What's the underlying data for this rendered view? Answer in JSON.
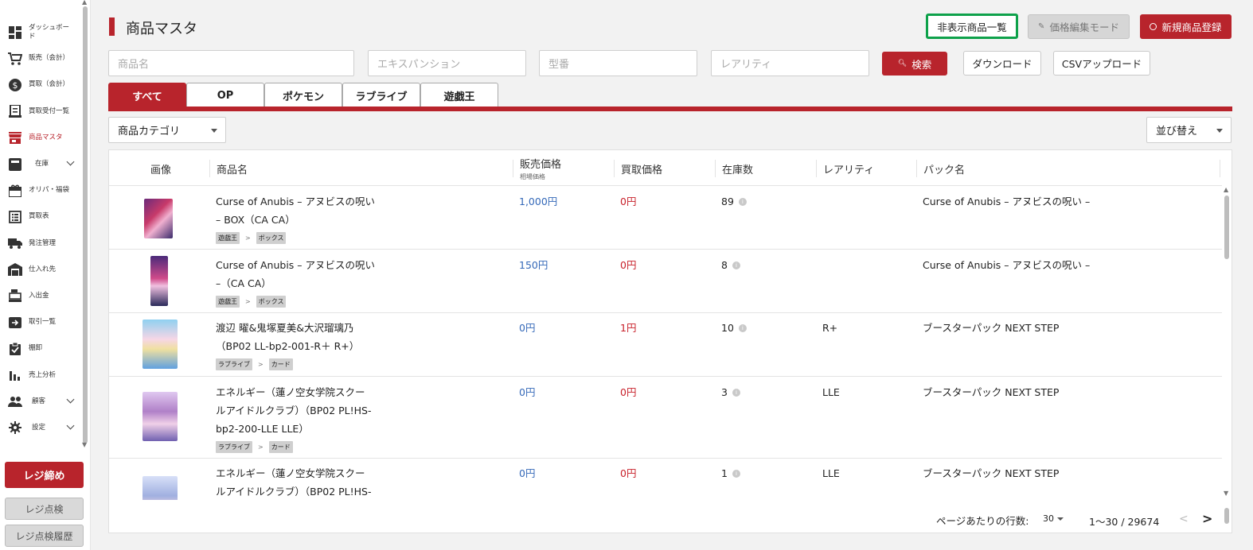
{
  "sidebar": {
    "items": [
      {
        "label": "ダッシュボード",
        "icon": "dashboard-icon"
      },
      {
        "label": "販売（会計）",
        "icon": "cart-icon"
      },
      {
        "label": "買取（会計）",
        "icon": "dollar-icon"
      },
      {
        "label": "買取受付一覧",
        "icon": "receipt-icon"
      },
      {
        "label": "商品マスタ",
        "icon": "store-icon",
        "active": true
      },
      {
        "label": "在庫",
        "icon": "inbox-icon",
        "expandable": true
      },
      {
        "label": "オリパ・福袋",
        "icon": "gift-icon"
      },
      {
        "label": "買取表",
        "icon": "list-icon"
      },
      {
        "label": "発注管理",
        "icon": "truck-icon"
      },
      {
        "label": "仕入れ先",
        "icon": "warehouse-icon"
      },
      {
        "label": "入出金",
        "icon": "register-icon"
      },
      {
        "label": "取引一覧",
        "icon": "transaction-icon"
      },
      {
        "label": "棚卸",
        "icon": "checklist-icon"
      },
      {
        "label": "売上分析",
        "icon": "bar-chart-icon"
      },
      {
        "label": "顧客",
        "icon": "people-icon",
        "expandable": true
      },
      {
        "label": "設定",
        "icon": "gear-icon",
        "expandable": true
      }
    ],
    "close_register_label": "レジ締め",
    "register_check_label": "レジ点検",
    "register_history_label": "レジ点検履歴"
  },
  "header": {
    "title": "商品マスタ",
    "hidden_list_label": "非表示商品一覧",
    "price_edit_label": "価格編集モード",
    "new_product_label": "新規商品登録"
  },
  "filters": {
    "name_placeholder": "商品名",
    "expansion_placeholder": "エキスパンション",
    "model_placeholder": "型番",
    "rarity_placeholder": "レアリティ",
    "search_label": "検索",
    "download_label": "ダウンロード",
    "csv_upload_label": "CSVアップロード"
  },
  "tabs": [
    "すべて",
    "OP",
    "ポケモン",
    "ラブライブ",
    "遊戯王"
  ],
  "category_select": "商品カテゴリ",
  "sort_select": "並び替え",
  "table": {
    "headers": {
      "image": "画像",
      "name": "商品名",
      "sale_price": "販売価格",
      "sale_price_sub": "相場価格",
      "buy_price": "買取価格",
      "stock": "在庫数",
      "rarity": "レアリティ",
      "pack": "パック名"
    },
    "rows": [
      {
        "name1": "Curse of Anubis – アヌビスの呪い",
        "name2": "– BOX（CA CA）",
        "name3": "",
        "tag1": "遊戯王",
        "tag2": "ボックス",
        "sale": "1,000円",
        "buy": "0円",
        "stock": "89",
        "rarity": "",
        "pack": "Curse of Anubis – アヌビスの呪い –"
      },
      {
        "name1": "Curse of Anubis – アヌビスの呪い",
        "name2": "–（CA CA）",
        "name3": "",
        "tag1": "遊戯王",
        "tag2": "ボックス",
        "sale": "150円",
        "buy": "0円",
        "stock": "8",
        "rarity": "",
        "pack": "Curse of Anubis – アヌビスの呪い –"
      },
      {
        "name1": "渡辺 曜&鬼塚夏美&大沢瑠璃乃",
        "name2": "（BP02 LL-bp2-001-R＋ R+）",
        "name3": "",
        "tag1": "ラブライブ",
        "tag2": "カード",
        "sale": "0円",
        "buy": "1円",
        "stock": "10",
        "rarity": "R+",
        "pack": "ブースターパック NEXT STEP"
      },
      {
        "name1": "エネルギー（蓮ノ空女学院スクー",
        "name2": "ルアイドルクラブ）（BP02 PL!HS-",
        "name3": "bp2-200-LLE LLE）",
        "tag1": "ラブライブ",
        "tag2": "カード",
        "sale": "0円",
        "buy": "0円",
        "stock": "3",
        "rarity": "LLE",
        "pack": "ブースターパック NEXT STEP"
      },
      {
        "name1": "エネルギー（蓮ノ空女学院スクー",
        "name2": "ルアイドルクラブ）（BP02 PL!HS-",
        "name3": "",
        "tag1": "",
        "tag2": "",
        "sale": "0円",
        "buy": "0円",
        "stock": "1",
        "rarity": "LLE",
        "pack": "ブースターパック NEXT STEP"
      }
    ]
  },
  "pagination": {
    "rows_per_page_label": "ページあたりの行数:",
    "rows_per_page": "30",
    "range": "1～30 / 29674"
  },
  "colors": {
    "accent": "#b8242c",
    "highlight": "#0ea14a",
    "sale_price": "#3468b8",
    "buy_price": "#c8202a"
  }
}
